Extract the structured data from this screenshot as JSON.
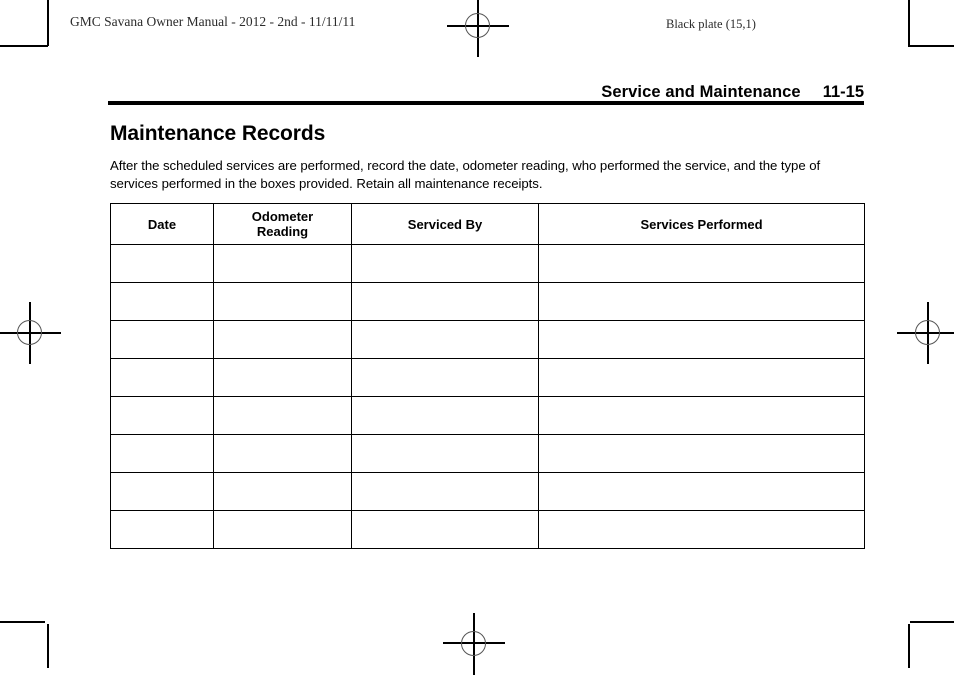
{
  "page_header": {
    "doc_id": "GMC Savana Owner Manual - 2012 - 2nd - 11/11/11",
    "plate_id": "Black plate (15,1)"
  },
  "section": {
    "title": "Service and Maintenance",
    "page_number": "11-15"
  },
  "main": {
    "heading": "Maintenance Records",
    "intro": "After the scheduled services are performed, record the date, odometer reading, who performed the service, and the type of services performed in the boxes provided. Retain all maintenance receipts."
  },
  "table": {
    "columns": [
      {
        "key": "date",
        "label": "Date",
        "label_line1": "Date",
        "label_line2": ""
      },
      {
        "key": "odometer",
        "label": "Odometer Reading",
        "label_line1": "Odometer",
        "label_line2": "Reading"
      },
      {
        "key": "serviced_by",
        "label": "Serviced By",
        "label_line1": "Serviced By",
        "label_line2": ""
      },
      {
        "key": "services_performed",
        "label": "Services Performed",
        "label_line1": "Services Performed",
        "label_line2": ""
      }
    ],
    "rows": [
      {
        "date": "",
        "odometer": "",
        "serviced_by": "",
        "services_performed": ""
      },
      {
        "date": "",
        "odometer": "",
        "serviced_by": "",
        "services_performed": ""
      },
      {
        "date": "",
        "odometer": "",
        "serviced_by": "",
        "services_performed": ""
      },
      {
        "date": "",
        "odometer": "",
        "serviced_by": "",
        "services_performed": ""
      },
      {
        "date": "",
        "odometer": "",
        "serviced_by": "",
        "services_performed": ""
      },
      {
        "date": "",
        "odometer": "",
        "serviced_by": "",
        "services_performed": ""
      },
      {
        "date": "",
        "odometer": "",
        "serviced_by": "",
        "services_performed": ""
      },
      {
        "date": "",
        "odometer": "",
        "serviced_by": "",
        "services_performed": ""
      }
    ],
    "row_count": 8
  },
  "print_marks": {
    "registration_mark_name": "registration-crosshair-mark",
    "corner_mark_name": "corner-crop-mark",
    "color": "#000000"
  }
}
